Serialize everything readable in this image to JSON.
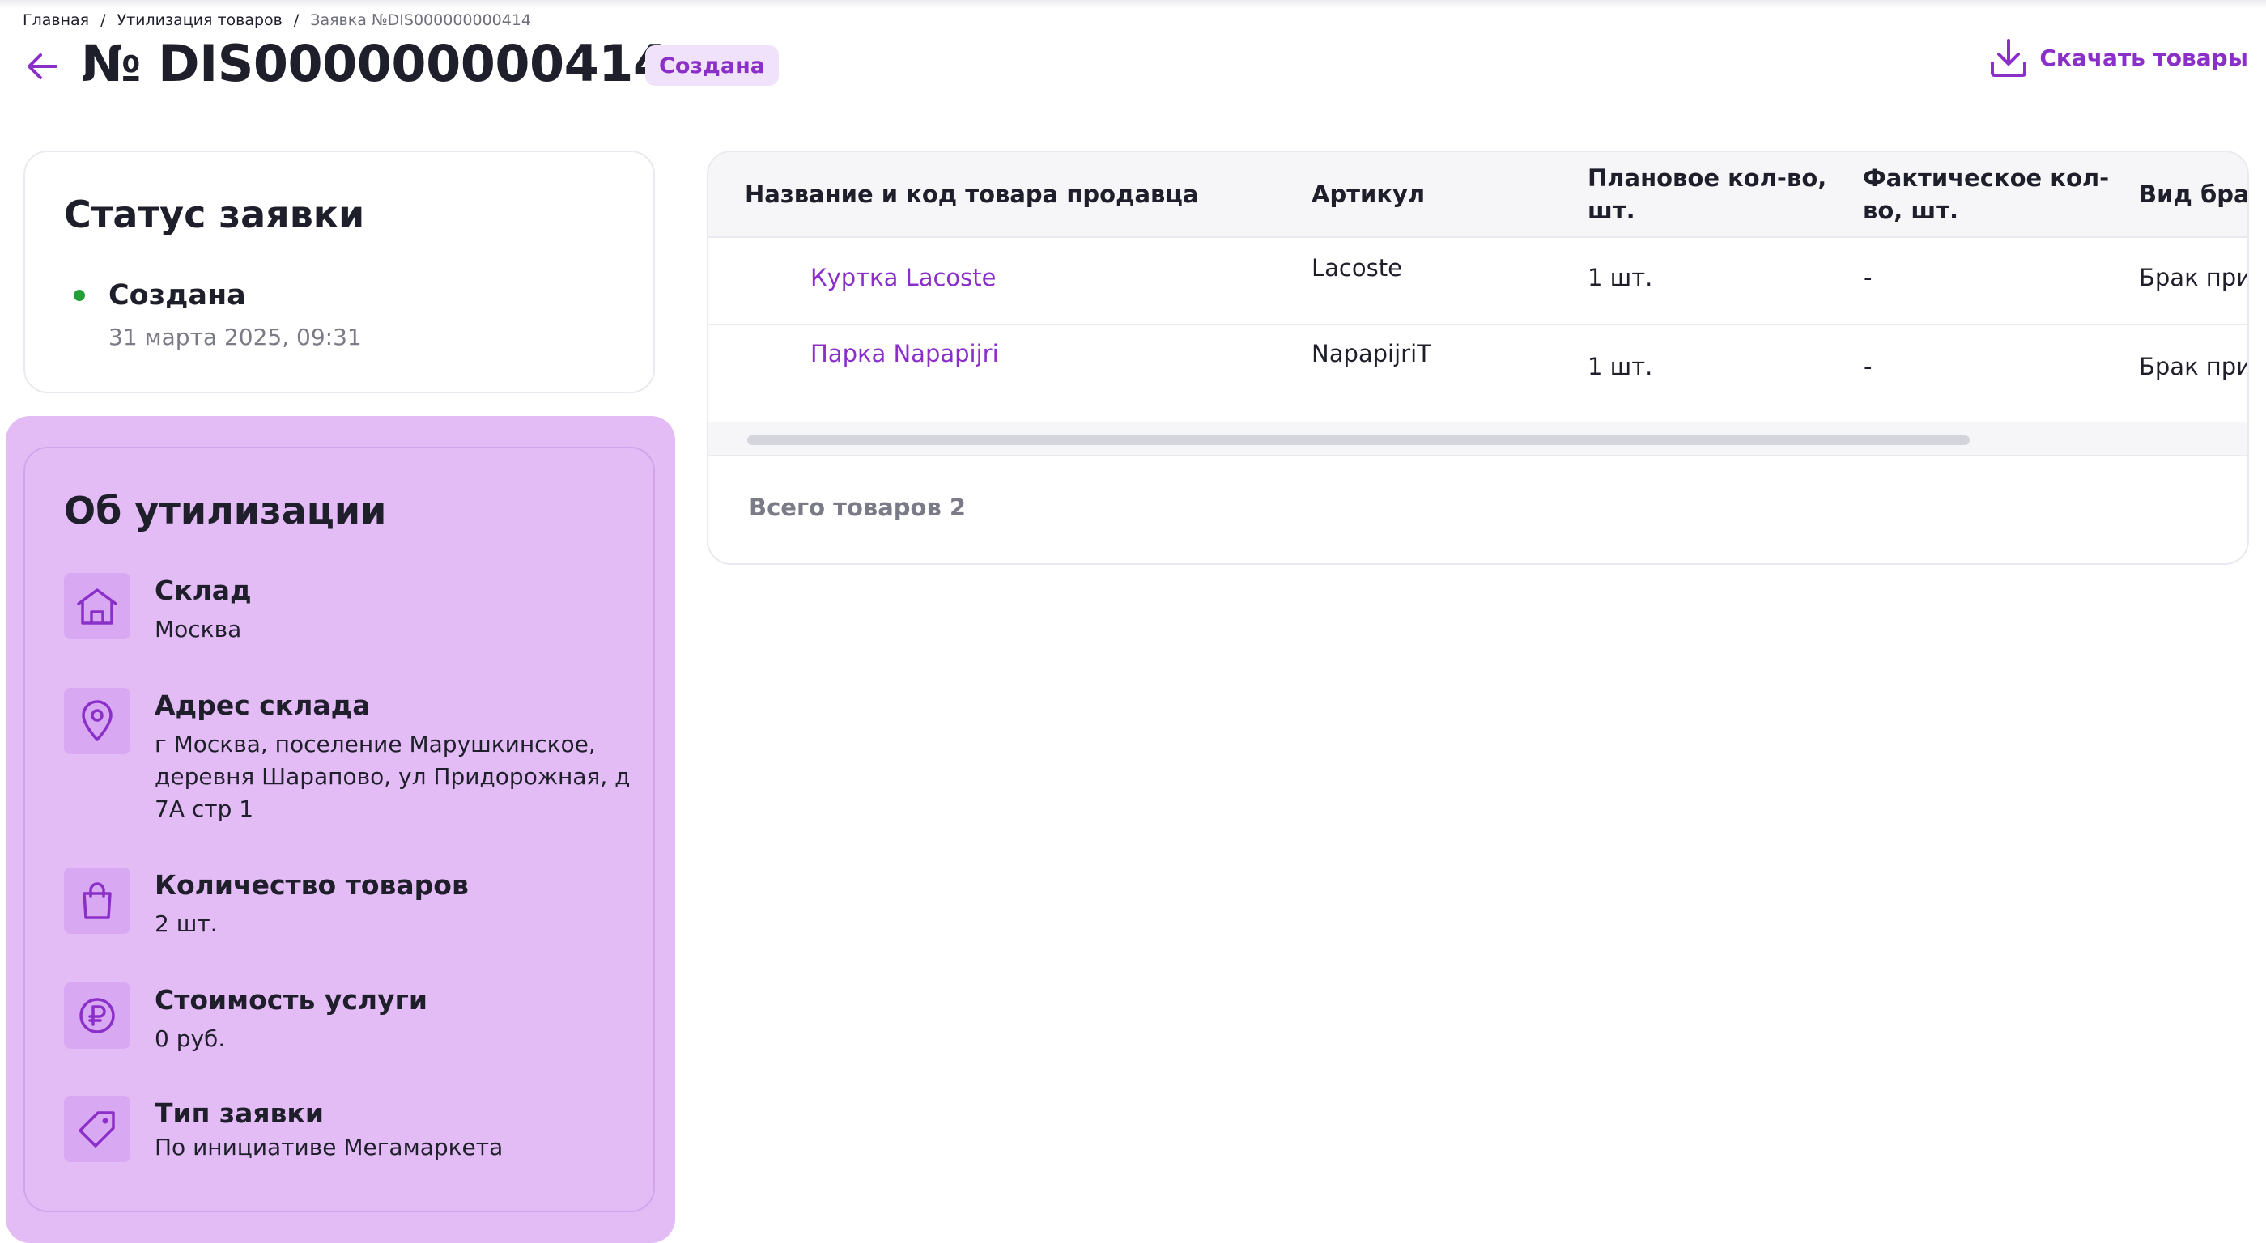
{
  "breadcrumb": {
    "home": "Главная",
    "section": "Утилизация товаров",
    "current": "Заявка №DIS000000000414",
    "separator": "/"
  },
  "header": {
    "title": "№ DIS000000000414",
    "badge": "Создана",
    "download_label": "Скачать товары"
  },
  "status_card": {
    "title": "Статус заявки",
    "status": "Создана",
    "date": "31 марта 2025, 09:31"
  },
  "info_card": {
    "title": "Об утилизации",
    "items": [
      {
        "icon": "warehouse-icon",
        "label": "Склад",
        "value": "Москва"
      },
      {
        "icon": "location-pin-icon",
        "label": "Адрес склада",
        "value": "г Москва, поселение Марушкинское, деревня Шарапово, ул Придорожная, д 7А стр 1"
      },
      {
        "icon": "shopping-bag-icon",
        "label": "Количество товаров",
        "value": "2 шт."
      },
      {
        "icon": "ruble-icon",
        "label": "Стоимость услуги",
        "value": "0 руб."
      },
      {
        "icon": "tag-icon",
        "label": "Тип заявки",
        "value": "По инициативе Мегамаркета"
      }
    ]
  },
  "table": {
    "columns": [
      "Название и код товара продавца",
      "Артикул",
      "Плановое кол-во, шт.",
      "Фактическое кол-во, шт.",
      "Вид брака"
    ],
    "column_lines": [
      [
        "Название и код товара продавца"
      ],
      [
        "Артикул"
      ],
      [
        "Плановое кол-во,",
        "шт."
      ],
      [
        "Фактическое кол-",
        "во, шт."
      ],
      [
        "Вид брака"
      ]
    ],
    "rows": [
      {
        "name": "Куртка Lacoste",
        "article": "Lacoste",
        "planned": "1 шт.",
        "actual": "-",
        "defect": "Брак принят"
      },
      {
        "name": "Парка Napapijri",
        "article": "NapapijriT",
        "planned": "1 шт.",
        "actual": "-",
        "defect": "Брак принят"
      }
    ],
    "total": "Всего товаров 2"
  },
  "colors": {
    "accent": "#8b2fc9",
    "badge_bg": "#f1e2fb",
    "highlight_bg": "#e3bcf5",
    "status_green": "#21a038"
  }
}
